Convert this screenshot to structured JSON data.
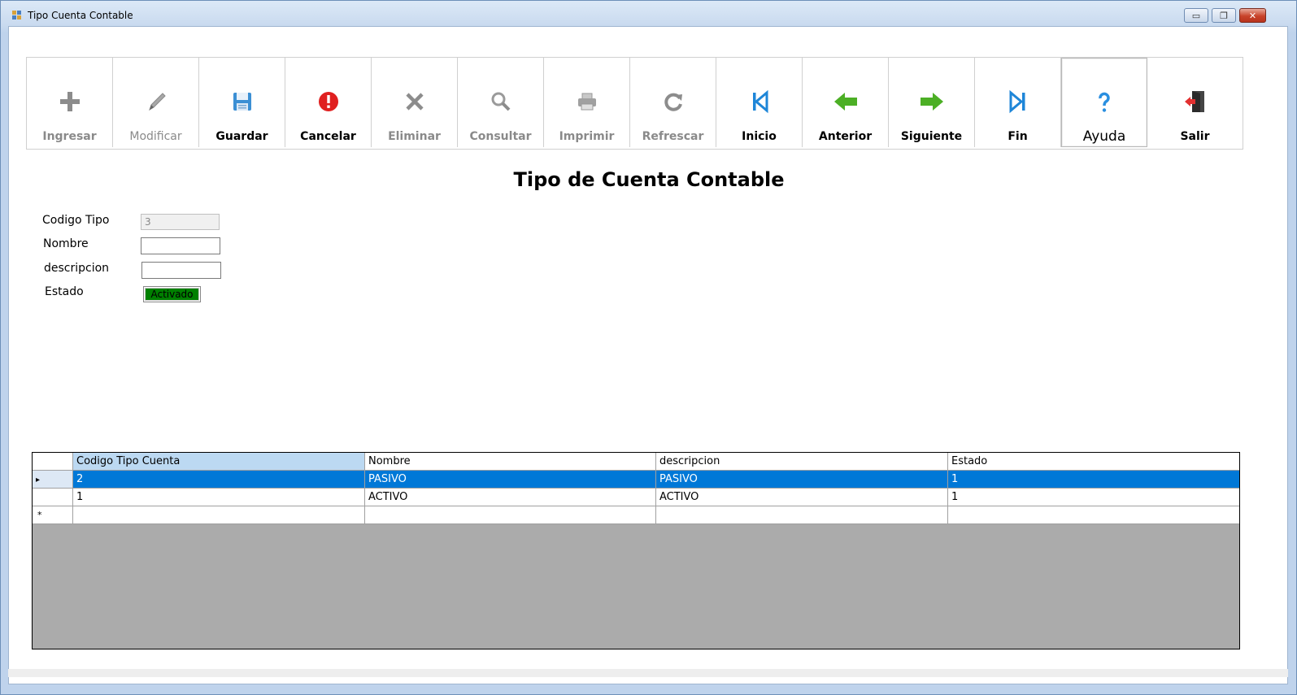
{
  "window": {
    "title": "Tipo Cuenta Contable",
    "controls": {
      "minimize": "▭",
      "maximize": "❐",
      "close": "✕"
    }
  },
  "toolbar": [
    {
      "label": "Ingresar",
      "icon": "plus-icon",
      "enabled": false
    },
    {
      "label": "Modificar",
      "icon": "pencil-icon",
      "enabled": false
    },
    {
      "label": "Guardar",
      "icon": "floppy-disk-icon",
      "enabled": true
    },
    {
      "label": "Cancelar",
      "icon": "error-circle-icon",
      "enabled": true
    },
    {
      "label": "Eliminar",
      "icon": "x-delete-icon",
      "enabled": false
    },
    {
      "label": "Consultar",
      "icon": "magnifier-icon",
      "enabled": false
    },
    {
      "label": "Imprimir",
      "icon": "printer-icon",
      "enabled": false
    },
    {
      "label": "Refrescar",
      "icon": "refresh-icon",
      "enabled": false
    },
    {
      "label": "Inicio",
      "icon": "skip-first-icon",
      "enabled": true
    },
    {
      "label": "Anterior",
      "icon": "arrow-left-icon",
      "enabled": true
    },
    {
      "label": "Siguiente",
      "icon": "arrow-right-icon",
      "enabled": true
    },
    {
      "label": "Fin",
      "icon": "skip-last-icon",
      "enabled": true
    },
    {
      "label": "Ayuda",
      "icon": "help-question-icon",
      "enabled": true
    },
    {
      "label": "Salir",
      "icon": "exit-door-icon",
      "enabled": true
    }
  ],
  "form": {
    "heading": "Tipo de Cuenta Contable",
    "codigo_label": "Codigo Tipo",
    "codigo_value": "3",
    "nombre_label": "Nombre",
    "nombre_value": "",
    "descripcion_label": "descripcion",
    "descripcion_value": "",
    "estado_label": "Estado",
    "estado_value": "Activado"
  },
  "grid": {
    "columns": [
      "Codigo Tipo Cuenta",
      "Nombre",
      "descripcion",
      "Estado"
    ],
    "rows": [
      [
        "2",
        "PASIVO",
        "PASIVO",
        "1"
      ],
      [
        "1",
        "ACTIVO",
        "ACTIVO",
        "1"
      ]
    ],
    "current_row_marker": "▸",
    "new_row_marker": "*"
  },
  "colors": {
    "selection": "#0078d7",
    "estado_active": "#008000",
    "header_selected": "#bcd9f2",
    "grid_background": "#ababab"
  }
}
